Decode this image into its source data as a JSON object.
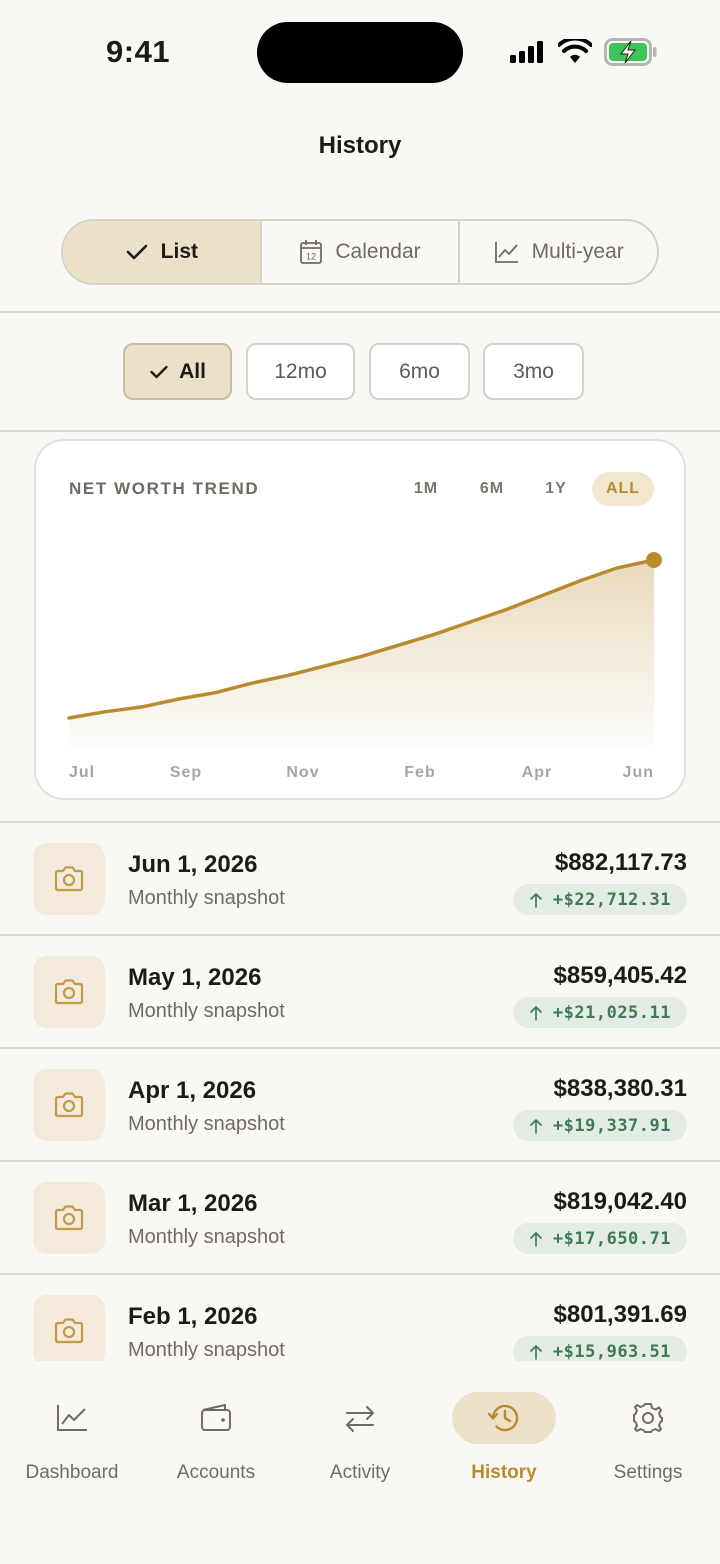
{
  "status_bar": {
    "time": "9:41"
  },
  "page": {
    "title": "History"
  },
  "view_modes": [
    {
      "label": "List",
      "icon": "check-icon",
      "active": true
    },
    {
      "label": "Calendar",
      "icon": "calendar-icon",
      "active": false
    },
    {
      "label": "Multi-year",
      "icon": "line-chart-icon",
      "active": false
    }
  ],
  "filters": [
    {
      "label": "All",
      "active": true
    },
    {
      "label": "12mo",
      "active": false
    },
    {
      "label": "6mo",
      "active": false
    },
    {
      "label": "3mo",
      "active": false
    }
  ],
  "chart": {
    "title": "NET WORTH TREND",
    "ranges": [
      {
        "label": "1M",
        "active": false
      },
      {
        "label": "6M",
        "active": false
      },
      {
        "label": "1Y",
        "active": false
      },
      {
        "label": "ALL",
        "active": true
      }
    ]
  },
  "chart_data": {
    "type": "area",
    "title": "NET WORTH TREND",
    "x_tick_labels": [
      "Jul",
      "Sep",
      "Nov",
      "Feb",
      "Apr",
      "Jun"
    ],
    "series": [
      {
        "values": [
          0.0,
          0.04,
          0.07,
          0.12,
          0.16,
          0.22,
          0.27,
          0.33,
          0.39,
          0.46,
          0.53,
          0.61,
          0.69,
          0.78,
          0.87,
          0.95,
          1.0
        ]
      }
    ],
    "y_unit": "relative (no axis printed)",
    "grid": false,
    "color": "#b98a2e",
    "end_marker": true
  },
  "snapshots": [
    {
      "date": "Jun 1, 2026",
      "label": "Monthly snapshot",
      "amount": "$882,117.73",
      "change": "+$22,712.31"
    },
    {
      "date": "May 1, 2026",
      "label": "Monthly snapshot",
      "amount": "$859,405.42",
      "change": "+$21,025.11"
    },
    {
      "date": "Apr 1, 2026",
      "label": "Monthly snapshot",
      "amount": "$838,380.31",
      "change": "+$19,337.91"
    },
    {
      "date": "Mar 1, 2026",
      "label": "Monthly snapshot",
      "amount": "$819,042.40",
      "change": "+$17,650.71"
    },
    {
      "date": "Feb 1, 2026",
      "label": "Monthly snapshot",
      "amount": "$801,391.69",
      "change": "+$15,963.51"
    }
  ],
  "tabs": [
    {
      "label": "Dashboard",
      "icon": "chart-icon",
      "active": false
    },
    {
      "label": "Accounts",
      "icon": "wallet-icon",
      "active": false
    },
    {
      "label": "Activity",
      "icon": "arrows-icon",
      "active": false
    },
    {
      "label": "History",
      "icon": "history-icon",
      "active": true
    },
    {
      "label": "Settings",
      "icon": "gear-icon",
      "active": false
    }
  ],
  "colors": {
    "accent": "#b98a2e",
    "accent_soft": "#ede0c8",
    "positive": "#3f7a52",
    "positive_bg": "#e2ece4",
    "background": "#faf8f4"
  }
}
